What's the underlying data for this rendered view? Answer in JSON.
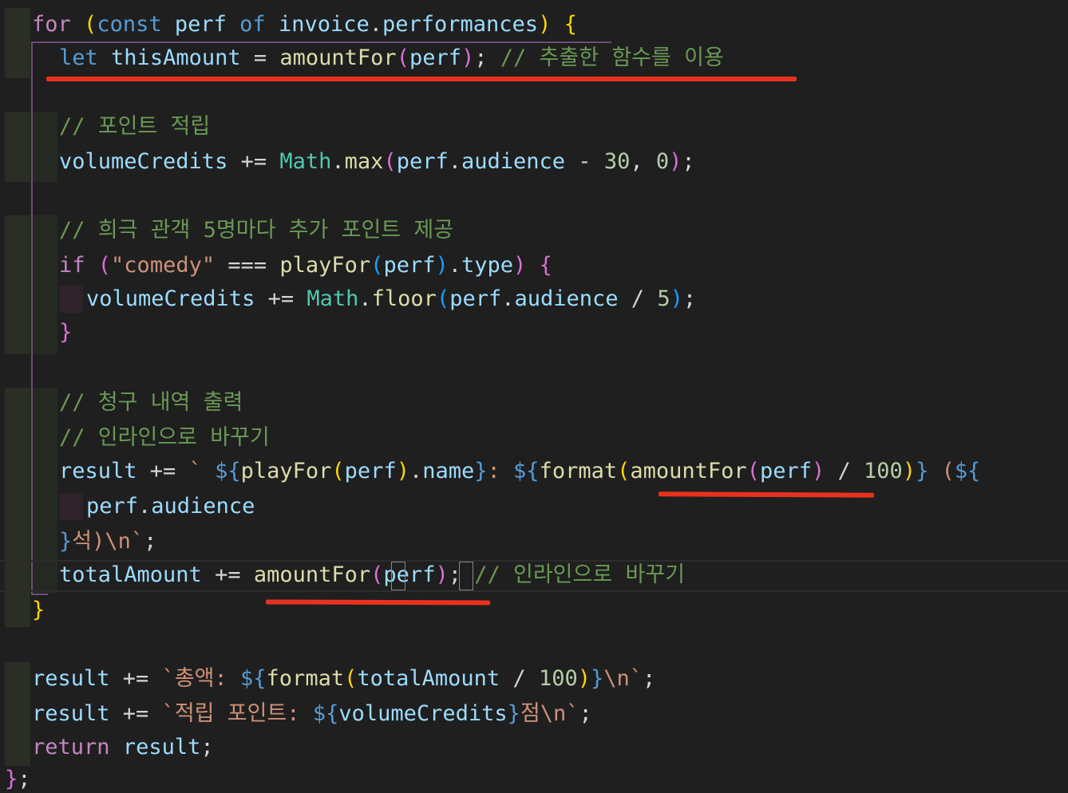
{
  "editor": {
    "lines": [
      [
        [
          "for",
          "kw"
        ],
        [
          " ",
          "plain"
        ],
        [
          "(",
          "b1"
        ],
        [
          "const",
          "decl"
        ],
        [
          " ",
          "plain"
        ],
        [
          "perf",
          "var"
        ],
        [
          " ",
          "plain"
        ],
        [
          "of",
          "decl"
        ],
        [
          " ",
          "plain"
        ],
        [
          "invoice",
          "var"
        ],
        [
          ".",
          "plain"
        ],
        [
          "performances",
          "var"
        ],
        [
          "",
          "plain"
        ],
        [
          ")",
          "b1"
        ],
        [
          " ",
          "plain"
        ],
        [
          "{",
          "b1"
        ]
      ],
      [
        [
          "let",
          "decl"
        ],
        [
          " ",
          "plain"
        ],
        [
          "thisAmount",
          "var"
        ],
        [
          " = ",
          "op"
        ],
        [
          "amountFor",
          "fn"
        ],
        [
          "(",
          "b2"
        ],
        [
          "perf",
          "var"
        ],
        [
          ")",
          "b2"
        ],
        [
          "; ",
          "plain"
        ],
        [
          "// 추출한 함수를 이용",
          "cm"
        ]
      ],
      [],
      [
        [
          "// 포인트 적립",
          "cm"
        ]
      ],
      [
        [
          "volumeCredits",
          "var"
        ],
        [
          " += ",
          "op"
        ],
        [
          "Math",
          "cls"
        ],
        [
          ".",
          "plain"
        ],
        [
          "max",
          "fn"
        ],
        [
          "(",
          "b2"
        ],
        [
          "perf",
          "var"
        ],
        [
          ".",
          "plain"
        ],
        [
          "audience",
          "var"
        ],
        [
          " - ",
          "op"
        ],
        [
          "30",
          "num"
        ],
        [
          ", ",
          "plain"
        ],
        [
          "0",
          "num"
        ],
        [
          ")",
          "b2"
        ],
        [
          ";",
          "plain"
        ]
      ],
      [],
      [
        [
          "// 희극 관객 5명마다 추가 포인트 제공",
          "cm"
        ]
      ],
      [
        [
          "if",
          "kw"
        ],
        [
          " ",
          "plain"
        ],
        [
          "(",
          "b2"
        ],
        [
          "\"comedy\"",
          "str"
        ],
        [
          " === ",
          "op"
        ],
        [
          "playFor",
          "fn"
        ],
        [
          "(",
          "b3"
        ],
        [
          "perf",
          "var"
        ],
        [
          ")",
          "b3"
        ],
        [
          ".",
          "plain"
        ],
        [
          "type",
          "var"
        ],
        [
          ")",
          "b2"
        ],
        [
          " ",
          "plain"
        ],
        [
          "{",
          "b2"
        ]
      ],
      [
        [
          "volumeCredits",
          "var"
        ],
        [
          " += ",
          "op"
        ],
        [
          "Math",
          "cls"
        ],
        [
          ".",
          "plain"
        ],
        [
          "floor",
          "fn"
        ],
        [
          "(",
          "b3"
        ],
        [
          "perf",
          "var"
        ],
        [
          ".",
          "plain"
        ],
        [
          "audience",
          "var"
        ],
        [
          " / ",
          "op"
        ],
        [
          "5",
          "num"
        ],
        [
          ")",
          "b3"
        ],
        [
          ";",
          "plain"
        ]
      ],
      [
        [
          "}",
          "b2"
        ]
      ],
      [],
      [
        [
          "// 청구 내역 출력",
          "cm"
        ]
      ],
      [
        [
          "// 인라인으로 바꾸기",
          "cm"
        ]
      ],
      [
        [
          "result",
          "var"
        ],
        [
          " += ",
          "op"
        ],
        [
          "` ",
          "str"
        ],
        [
          "${",
          "tpl"
        ],
        [
          "playFor",
          "fn"
        ],
        [
          "(",
          "b1"
        ],
        [
          "perf",
          "var"
        ],
        [
          ")",
          "b1"
        ],
        [
          ".",
          "plain"
        ],
        [
          "name",
          "var"
        ],
        [
          "}",
          "tpl"
        ],
        [
          ": ",
          "str"
        ],
        [
          "${",
          "tpl"
        ],
        [
          "format",
          "fn"
        ],
        [
          "(",
          "b1"
        ],
        [
          "amountFor",
          "fn"
        ],
        [
          "(",
          "b2"
        ],
        [
          "perf",
          "var"
        ],
        [
          ")",
          "b2"
        ],
        [
          " / ",
          "op"
        ],
        [
          "100",
          "num"
        ],
        [
          ")",
          "b1"
        ],
        [
          "}",
          "tpl"
        ],
        [
          " (",
          "str"
        ],
        [
          "${",
          "tpl"
        ]
      ],
      [
        [
          "perf",
          "var"
        ],
        [
          ".",
          "plain"
        ],
        [
          "audience",
          "var"
        ]
      ],
      [
        [
          "}",
          "tpl"
        ],
        [
          "석)\\n`",
          "str"
        ],
        [
          ";",
          "plain"
        ]
      ],
      [
        [
          "totalAmount",
          "var"
        ],
        [
          " += ",
          "op"
        ],
        [
          "amountFor",
          "fn"
        ],
        [
          "(",
          "b2"
        ],
        [
          "perf",
          "var"
        ],
        [
          ")",
          "b2"
        ],
        [
          "; ",
          "plain"
        ],
        [
          "// 인라인으로 바꾸기",
          "cm"
        ]
      ],
      [
        [
          "}",
          "b1"
        ]
      ],
      [],
      [
        [
          "result",
          "var"
        ],
        [
          " += ",
          "op"
        ],
        [
          "`총액: ",
          "str"
        ],
        [
          "${",
          "tpl"
        ],
        [
          "format",
          "fn"
        ],
        [
          "(",
          "b1"
        ],
        [
          "totalAmount",
          "var"
        ],
        [
          " / ",
          "op"
        ],
        [
          "100",
          "num"
        ],
        [
          ")",
          "b1"
        ],
        [
          "}",
          "tpl"
        ],
        [
          "\\n`",
          "str"
        ],
        [
          ";",
          "plain"
        ]
      ],
      [
        [
          "result",
          "var"
        ],
        [
          " += ",
          "op"
        ],
        [
          "`적립 포인트: ",
          "str"
        ],
        [
          "${",
          "tpl"
        ],
        [
          "volumeCredits",
          "var"
        ],
        [
          "}",
          "tpl"
        ],
        [
          "점\\n`",
          "str"
        ],
        [
          ";",
          "plain"
        ]
      ],
      [
        [
          "return",
          "kw"
        ],
        [
          " ",
          "plain"
        ],
        [
          "result",
          "var"
        ],
        [
          ";",
          "plain"
        ]
      ],
      [
        [
          "}",
          "b2"
        ],
        [
          ";",
          "plain"
        ]
      ]
    ],
    "colors": {
      "background": "#1f1f1f",
      "highlight_underline": "#e8321f",
      "indent_guide": "#6c4d7a"
    }
  }
}
